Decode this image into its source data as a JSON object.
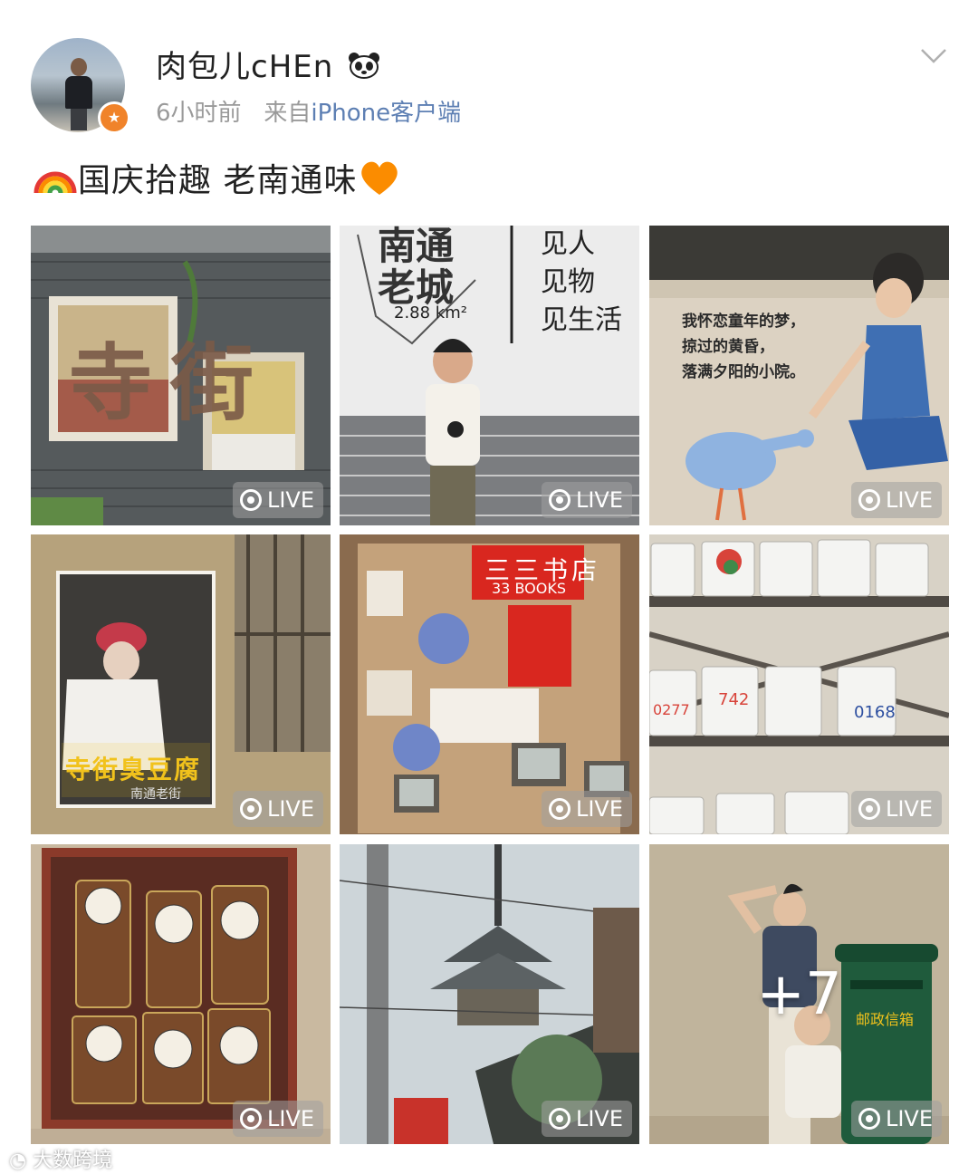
{
  "post": {
    "username": "肉包儿cHEn",
    "time": "6小时前",
    "from_prefix": "来自",
    "source": "iPhone客户端",
    "text": "国庆拾趣 老南通味"
  },
  "tiles": [
    {
      "live": "LIVE",
      "caption": "寺街"
    },
    {
      "live": "LIVE",
      "caption": "南通老城",
      "area": "2.88 km²",
      "slogan": [
        "见人",
        "见物",
        "见生活"
      ]
    },
    {
      "live": "LIVE",
      "mural": [
        "我怀恋童年的梦，",
        "掠过的黄昏，",
        "落满夕阳的小院。"
      ]
    },
    {
      "live": "LIVE",
      "poster": "寺街臭豆腐",
      "poster_sub": "南通老街"
    },
    {
      "live": "LIVE",
      "sign": "三三书店",
      "sign_en": "33 BOOKS"
    },
    {
      "live": "LIVE",
      "mugs": [
        "742",
        "0277",
        "0168"
      ]
    },
    {
      "live": "LIVE"
    },
    {
      "live": "LIVE"
    },
    {
      "live": "LIVE",
      "more": "+7",
      "mailbox": "邮政信箱"
    }
  ],
  "watermark": "大数跨境",
  "colors": {
    "link": "#5d7fb3",
    "meta": "#9a9a9a",
    "badge": "#f0832a"
  }
}
